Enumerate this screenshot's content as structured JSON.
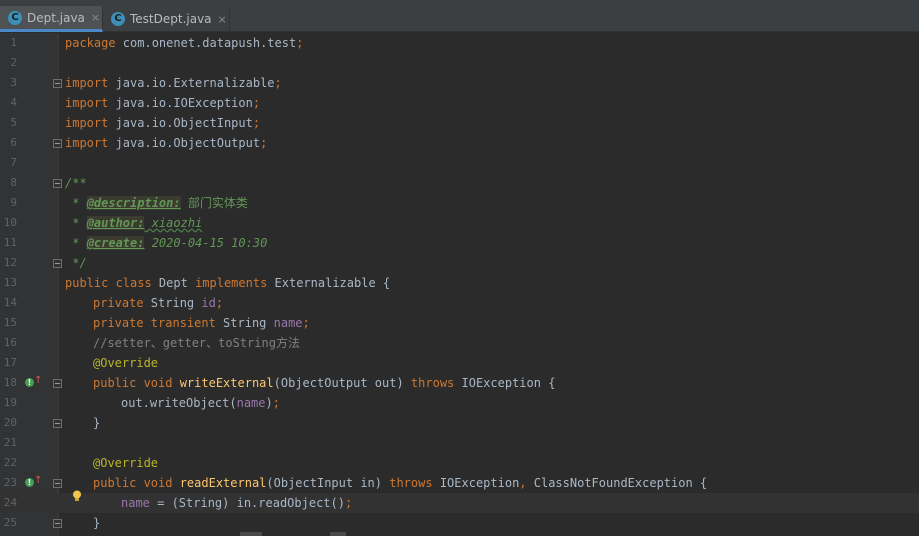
{
  "tabs": [
    {
      "label": "Dept.java",
      "icon": "java-class-icon",
      "close": "×",
      "active": true
    },
    {
      "label": "TestDept.java",
      "icon": "java-class-icon",
      "close": "×",
      "active": false
    }
  ],
  "lines": {
    "n": [
      "1",
      "2",
      "3",
      "4",
      "5",
      "6",
      "7",
      "8",
      "9",
      "10",
      "11",
      "12",
      "13",
      "14",
      "15",
      "16",
      "17",
      "18",
      "19",
      "20",
      "21",
      "22",
      "23",
      "24",
      "25"
    ]
  },
  "code": {
    "l1": {
      "kw": "package",
      "rest": " com.onenet.datapush.test",
      "semi": ";"
    },
    "l3": {
      "kw": "import",
      "rest": " java.io.Externalizable",
      "semi": ";"
    },
    "l4": {
      "kw": "import",
      "rest": " java.io.IOException",
      "semi": ";"
    },
    "l5": {
      "kw": "import",
      "rest": " java.io.ObjectInput",
      "semi": ";"
    },
    "l6": {
      "kw": "import",
      "rest": " java.io.ObjectOutput",
      "semi": ";"
    },
    "l8": {
      "text": "/**"
    },
    "l9": {
      "star": " * ",
      "tag": "@description:",
      "text": " 部门实体类"
    },
    "l10": {
      "star": " * ",
      "tag": "@author:",
      "text": " xiaozhi"
    },
    "l11": {
      "star": " * ",
      "tag": "@create:",
      "text": " 2020-04-15 10:30"
    },
    "l12": {
      "text": " */"
    },
    "l13": {
      "kw1": "public class",
      "name": " Dept ",
      "kw2": "implements",
      "rest": " Externalizable {"
    },
    "l14": {
      "kw": "private",
      "type": " String ",
      "field": "id",
      "semi": ";"
    },
    "l15": {
      "kw": "private transient",
      "type": " String ",
      "field": "name",
      "semi": ";"
    },
    "l16": {
      "text": "//setter、getter、toString方法"
    },
    "l17": {
      "text": "@Override"
    },
    "l18": {
      "kw": "public void",
      "method": " writeExternal",
      "args": "(ObjectOutput out) ",
      "throws": "throws",
      "rest": " IOException {"
    },
    "l19": {
      "pre": "out.writeObject(",
      "field": "name",
      "post": ")",
      "semi": ";"
    },
    "l20": {
      "text": "}"
    },
    "l22": {
      "text": "@Override"
    },
    "l23": {
      "kw": "public void",
      "method": " readExternal",
      "args": "(ObjectInput in) ",
      "throws": "throws",
      "rest": " IOException",
      "comma": ",",
      "rest2": " ClassNotFoundException {"
    },
    "l24": {
      "field": "name",
      "pre": " = (String) in.readObject()",
      "semi": ";"
    },
    "l25": {
      "text": "}"
    }
  },
  "gutter_icons": {
    "override": "implements-method-icon",
    "arrow": "↑",
    "bulb": "lightbulb-icon"
  },
  "colors": {
    "background": "#2b2b2b",
    "keyword": "#cc7832",
    "comment": "#629755",
    "field": "#9876aa",
    "method": "#ffc66d",
    "annotation": "#bbb529",
    "text": "#a9b7c6"
  }
}
